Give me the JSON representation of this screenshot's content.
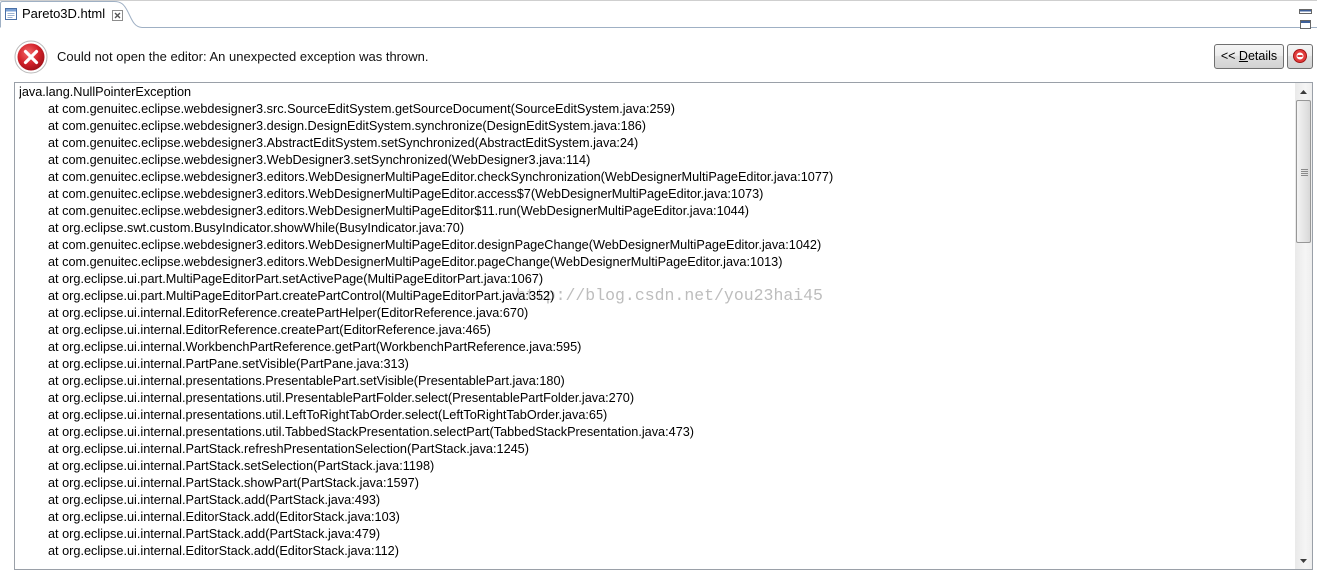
{
  "tab": {
    "title": "Pareto3D.html",
    "icon": "html-file-icon",
    "close_icon": "close-icon"
  },
  "view_controls": {
    "minimize_icon": "minimize-icon",
    "maximize_icon": "maximize-icon"
  },
  "error": {
    "icon": "error-icon",
    "message": "Could not open the editor: An unexpected exception was thrown."
  },
  "details_button": {
    "label": "<< Details",
    "mnemonic": "D"
  },
  "report_button": {
    "icon": "error-log-icon"
  },
  "details": {
    "lines": [
      "java.lang.NullPointerException",
      "at com.genuitec.eclipse.webdesigner3.src.SourceEditSystem.getSourceDocument(SourceEditSystem.java:259)",
      "at com.genuitec.eclipse.webdesigner3.design.DesignEditSystem.synchronize(DesignEditSystem.java:186)",
      "at com.genuitec.eclipse.webdesigner3.AbstractEditSystem.setSynchronized(AbstractEditSystem.java:24)",
      "at com.genuitec.eclipse.webdesigner3.WebDesigner3.setSynchronized(WebDesigner3.java:114)",
      "at com.genuitec.eclipse.webdesigner3.editors.WebDesignerMultiPageEditor.checkSynchronization(WebDesignerMultiPageEditor.java:1077)",
      "at com.genuitec.eclipse.webdesigner3.editors.WebDesignerMultiPageEditor.access$7(WebDesignerMultiPageEditor.java:1073)",
      "at com.genuitec.eclipse.webdesigner3.editors.WebDesignerMultiPageEditor$11.run(WebDesignerMultiPageEditor.java:1044)",
      "at org.eclipse.swt.custom.BusyIndicator.showWhile(BusyIndicator.java:70)",
      "at com.genuitec.eclipse.webdesigner3.editors.WebDesignerMultiPageEditor.designPageChange(WebDesignerMultiPageEditor.java:1042)",
      "at com.genuitec.eclipse.webdesigner3.editors.WebDesignerMultiPageEditor.pageChange(WebDesignerMultiPageEditor.java:1013)",
      "at org.eclipse.ui.part.MultiPageEditorPart.setActivePage(MultiPageEditorPart.java:1067)",
      "at org.eclipse.ui.part.MultiPageEditorPart.createPartControl(MultiPageEditorPart.java:352)",
      "at org.eclipse.ui.internal.EditorReference.createPartHelper(EditorReference.java:670)",
      "at org.eclipse.ui.internal.EditorReference.createPart(EditorReference.java:465)",
      "at org.eclipse.ui.internal.WorkbenchPartReference.getPart(WorkbenchPartReference.java:595)",
      "at org.eclipse.ui.internal.PartPane.setVisible(PartPane.java:313)",
      "at org.eclipse.ui.internal.presentations.PresentablePart.setVisible(PresentablePart.java:180)",
      "at org.eclipse.ui.internal.presentations.util.PresentablePartFolder.select(PresentablePartFolder.java:270)",
      "at org.eclipse.ui.internal.presentations.util.LeftToRightTabOrder.select(LeftToRightTabOrder.java:65)",
      "at org.eclipse.ui.internal.presentations.util.TabbedStackPresentation.selectPart(TabbedStackPresentation.java:473)",
      "at org.eclipse.ui.internal.PartStack.refreshPresentationSelection(PartStack.java:1245)",
      "at org.eclipse.ui.internal.PartStack.setSelection(PartStack.java:1198)",
      "at org.eclipse.ui.internal.PartStack.showPart(PartStack.java:1597)",
      "at org.eclipse.ui.internal.PartStack.add(PartStack.java:493)",
      "at org.eclipse.ui.internal.EditorStack.add(EditorStack.java:103)",
      "at org.eclipse.ui.internal.PartStack.add(PartStack.java:479)",
      "at org.eclipse.ui.internal.EditorStack.add(EditorStack.java:112)"
    ]
  },
  "scrollbar": {
    "scroll_position": 0,
    "up_icon": "scroll-up-arrow-icon",
    "down_icon": "scroll-down-arrow-icon"
  },
  "watermark": "http://blog.csdn.net/you23hai45",
  "colors": {
    "error_red": "#d3232b",
    "tab_border": "#9fb0c4",
    "text": "#000000"
  }
}
